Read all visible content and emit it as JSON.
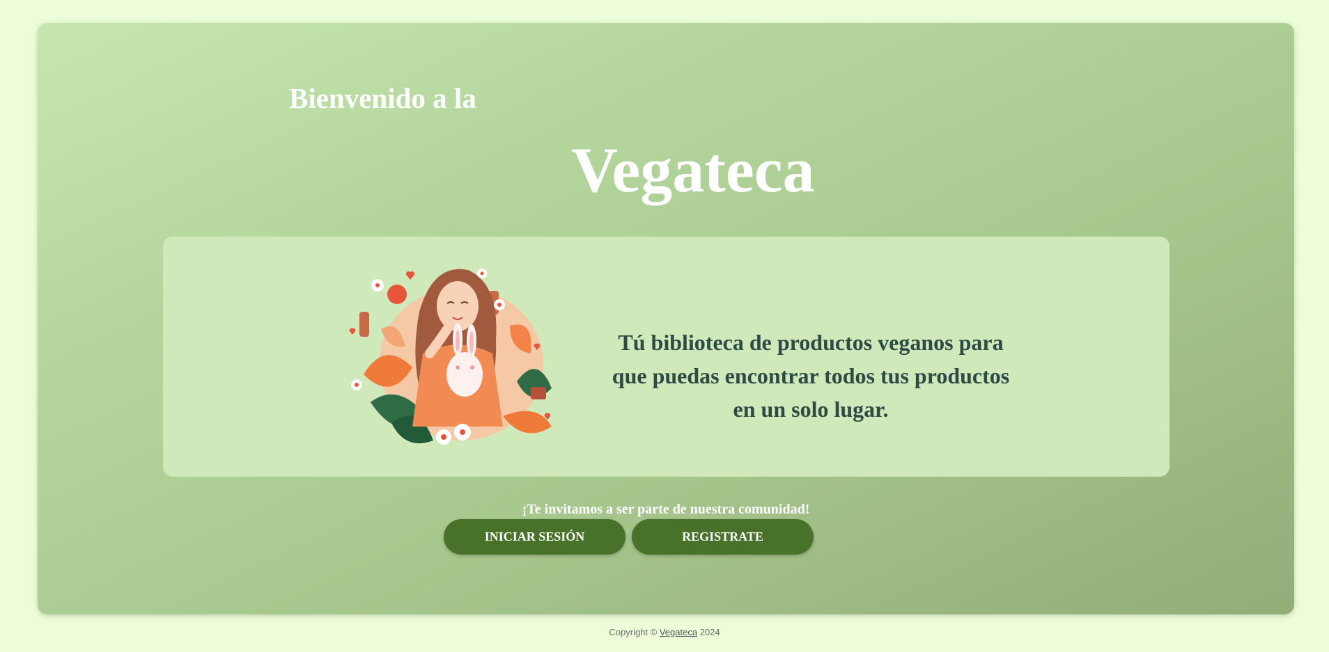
{
  "hero": {
    "welcome": "Bienvenido a la",
    "brand": "Vegateca"
  },
  "card": {
    "image_alt": "woman-with-bunny-illustration",
    "tagline_lines": [
      "Tú biblioteca de productos veganos para",
      "que puedas encontrar todos tus productos",
      "en un solo lugar."
    ]
  },
  "invite": "¡Te invitamos a ser parte de nuestra comunidad!",
  "buttons": {
    "login": "INICIAR SESIÓN",
    "register": "REGISTRATE"
  },
  "footer": {
    "prefix": "Copyright ©",
    "link": "Vegateca",
    "year": "2024"
  },
  "colors": {
    "page_bg": "#edfdd8",
    "button": "#48722a",
    "tagline": "#2e4a45"
  }
}
